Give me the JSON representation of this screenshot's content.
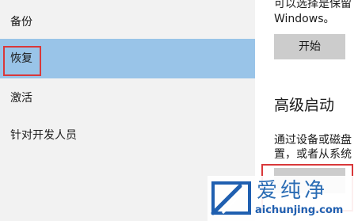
{
  "sidebar": {
    "items": [
      {
        "label": "备份",
        "active": false
      },
      {
        "label": "恢复",
        "active": true
      },
      {
        "label": "激活",
        "active": false
      },
      {
        "label": "针对开发人员",
        "active": false
      }
    ]
  },
  "main": {
    "reset_text_line1": "可以选择是保留",
    "reset_text_line2": "Windows。",
    "reset_start_button": "开始",
    "advanced_startup_title": "高级启动",
    "advanced_text_line1": "通过设备或磁盘",
    "advanced_text_line2": "置，或者从系统"
  },
  "watermark": {
    "title": "爱纯净",
    "url": "aichunjing.com"
  },
  "colors": {
    "sidebar_bg": "#f2f2f2",
    "active_item_bg": "#99c4e8",
    "highlight_border": "#d9383a",
    "button_bg": "#cccccc",
    "watermark_blue": "#2a6cb4"
  }
}
